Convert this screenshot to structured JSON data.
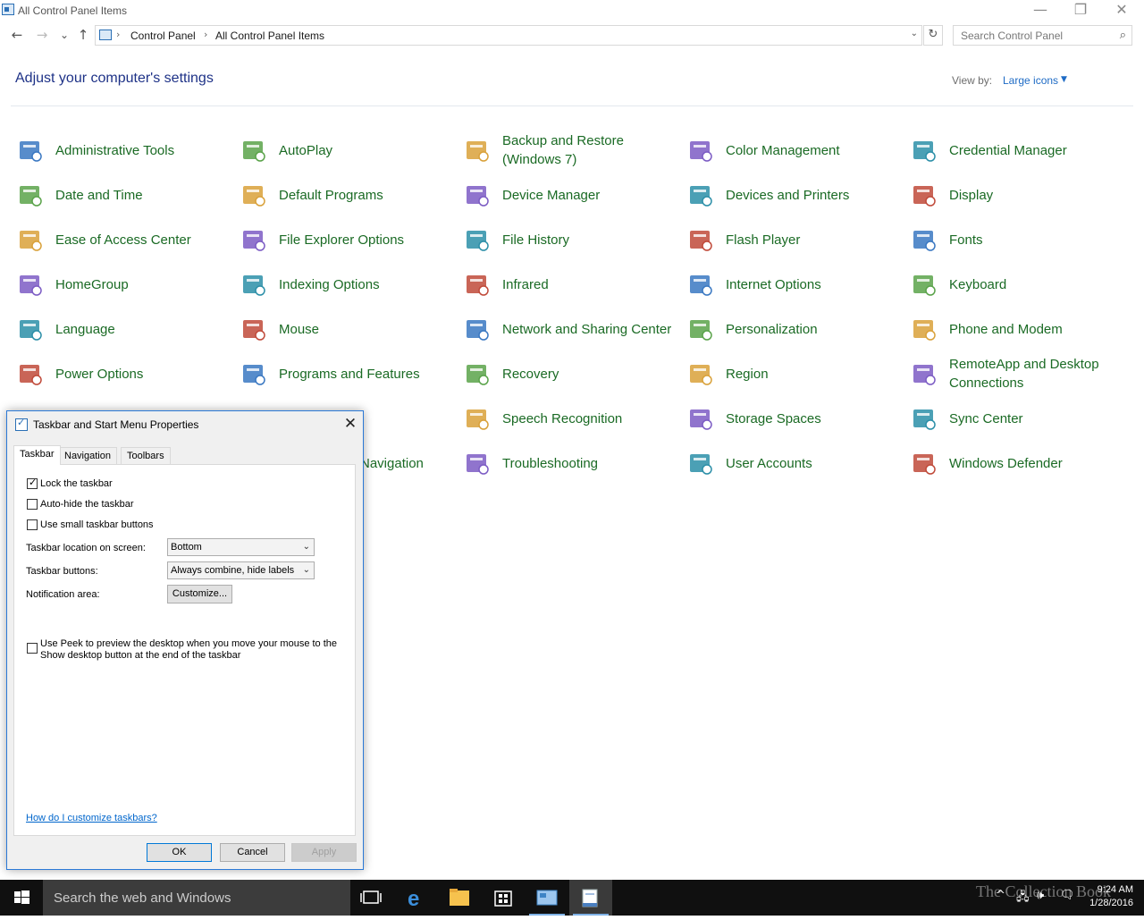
{
  "window": {
    "title": "All Control Panel Items",
    "minimize_glyph": "—",
    "restore_glyph": "❐",
    "close_glyph": "✕"
  },
  "nav": {
    "back": "←",
    "forward": "→",
    "recent": "⌄",
    "up": "↑",
    "breadcrumb": [
      "Control Panel",
      "All Control Panel Items"
    ],
    "breadcrumb_sep": "›",
    "refresh": "↻",
    "search_placeholder": "Search Control Panel"
  },
  "header": {
    "heading": "Adjust your computer's settings",
    "view_by_label": "View by:",
    "view_by_value": "Large icons"
  },
  "items": [
    [
      "Administrative Tools",
      "AutoPlay",
      "Backup and Restore (Windows 7)",
      "Color Management",
      "Credential Manager"
    ],
    [
      "Date and Time",
      "Default Programs",
      "Device Manager",
      "Devices and Printers",
      "Display"
    ],
    [
      "Ease of Access Center",
      "File Explorer Options",
      "File History",
      "Flash Player",
      "Fonts"
    ],
    [
      "HomeGroup",
      "Indexing Options",
      "Infrared",
      "Internet Options",
      "Keyboard"
    ],
    [
      "Language",
      "Mouse",
      "Network and Sharing Center",
      "Personalization",
      "Phone and Modem"
    ],
    [
      "Power Options",
      "Programs and Features",
      "Recovery",
      "Region",
      "RemoteApp and Desktop Connections"
    ],
    [
      "",
      "",
      "Speech Recognition",
      "Storage Spaces",
      "Sync Center"
    ],
    [
      "",
      "Navigation",
      "Troubleshooting",
      "User Accounts",
      "Windows Defender"
    ]
  ],
  "dialog": {
    "title": "Taskbar and Start Menu Properties",
    "close": "✕",
    "tabs": [
      "Taskbar",
      "Navigation",
      "Toolbars"
    ],
    "active_tab": "Taskbar",
    "lock_taskbar": {
      "label": "Lock the taskbar",
      "checked": true
    },
    "auto_hide": {
      "label": "Auto-hide the taskbar",
      "checked": false
    },
    "small_buttons": {
      "label": "Use small taskbar buttons",
      "checked": false
    },
    "location_label": "Taskbar location on screen:",
    "location_value": "Bottom",
    "buttons_label": "Taskbar buttons:",
    "buttons_value": "Always combine, hide labels",
    "notification_label": "Notification area:",
    "customize_button": "Customize...",
    "peek_line1": "Use Peek to preview the desktop when you move your mouse to the",
    "peek_line2": "Show desktop button at the end of the taskbar",
    "peek_checked": false,
    "help_link": "How do I customize taskbars?",
    "ok": "OK",
    "cancel": "Cancel",
    "apply": "Apply"
  },
  "taskbar": {
    "search_placeholder": "Search the web and Windows",
    "time": "9:24 AM",
    "date": "1/28/2016",
    "watermark": "The Collection Book"
  }
}
